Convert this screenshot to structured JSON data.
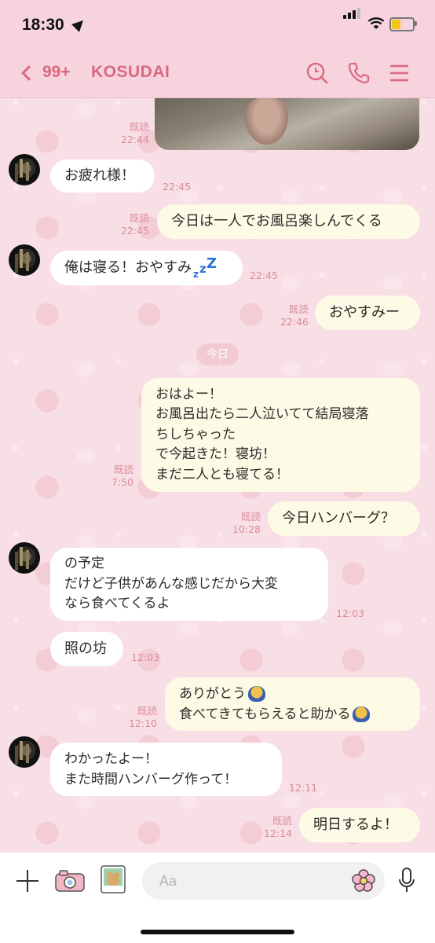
{
  "status_bar": {
    "time": "18:30"
  },
  "header": {
    "back_count": "99+",
    "title": "KOSUDAI"
  },
  "colors": {
    "accent": "#d9697f",
    "incoming_bubble": "#ffffff",
    "outgoing_bubble": "#fdfbe5",
    "background": "#f8dee5"
  },
  "icons": [
    "search-icon",
    "phone-icon",
    "menu-icon",
    "plus-icon",
    "camera-icon",
    "album-icon",
    "flower-icon",
    "mic-icon"
  ],
  "messages": {
    "photo": {
      "read": "既読",
      "time": "22:44"
    },
    "m1": {
      "text": "お疲れ様！",
      "time": "22:45"
    },
    "m2": {
      "text": "今日は一人でお風呂楽しんでくる",
      "read": "既読",
      "time": "22:45"
    },
    "m3": {
      "text": "俺は寝る！おやすみ",
      "time": "22:45"
    },
    "m4": {
      "text": "おやすみー",
      "read": "既読",
      "time": "22:46"
    },
    "date_separator": "今日",
    "m5": {
      "lines": [
        "おはよー！",
        "お風呂出たら二人泣いてて結局寝落",
        "ちしちゃった",
        "で今起きた！寝坊！",
        "まだ二人とも寝てる！"
      ],
      "read": "既読",
      "time": "7:50"
    },
    "m6": {
      "text": "今日ハンバーグ？",
      "read": "既読",
      "time": "10:28"
    },
    "m7": {
      "lines": [
        "の予定",
        "だけど子供があんな感じだから大変",
        "なら食べてくるよ"
      ],
      "time": "12:03"
    },
    "m8": {
      "text": "照の坊",
      "time": "12:03"
    },
    "m9": {
      "lines": [
        "ありがとう",
        "食べてきてもらえると助かる"
      ],
      "read": "既読",
      "time": "12:10"
    },
    "m10": {
      "lines": [
        "わかったよー！",
        "また時間ハンバーグ作って！"
      ],
      "time": "12:11"
    },
    "m11": {
      "text": "明日するよ！",
      "read": "既読",
      "time": "12:14"
    }
  },
  "input": {
    "placeholder": "Aa"
  }
}
